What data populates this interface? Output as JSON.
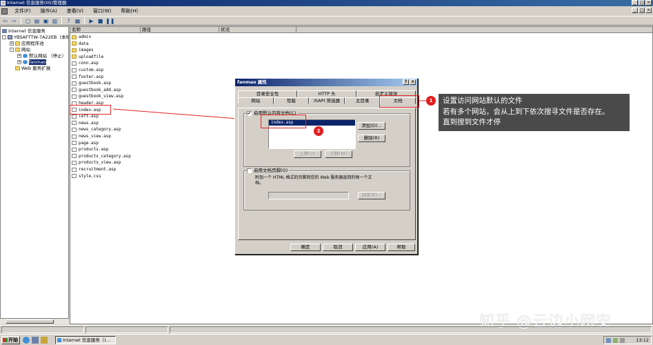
{
  "window": {
    "title": "Internet 信息服务(IIS)管理器",
    "min_glyph": "_",
    "max_glyph": "□",
    "close_glyph": "×"
  },
  "menu": {
    "items": [
      "文件(F)",
      "操作(A)",
      "查看(V)",
      "窗口(W)",
      "帮助(H)"
    ]
  },
  "toolbar": {
    "buttons": [
      "back-icon",
      "forward-icon",
      "up-icon",
      "show-hide-icon",
      "refresh-icon",
      "export-icon",
      "help-icon",
      "properties-icon",
      "play-icon",
      "stop-icon",
      "pause-icon"
    ],
    "glyphs": [
      "⇦",
      "⇨",
      "▢",
      "▤",
      "▣",
      "▥",
      "?",
      "▦",
      "▶",
      "■",
      "❚❚"
    ]
  },
  "tree": {
    "items": [
      {
        "label": "Internet 信息服务",
        "icon": "iis-icon",
        "indent": 0,
        "expander": ""
      },
      {
        "label": "YBSAFTTW-7A22EB（本地）",
        "icon": "computer-icon",
        "indent": 1,
        "expander": "-"
      },
      {
        "label": "应用程序池",
        "icon": "folder-icon",
        "indent": 2,
        "expander": "+"
      },
      {
        "label": "网站",
        "icon": "folder-icon",
        "indent": 2,
        "expander": "-"
      },
      {
        "label": "默认网站 （停止）",
        "icon": "globe-icon",
        "indent": 3,
        "expander": "+"
      },
      {
        "label": "fanmao",
        "icon": "globe-icon",
        "indent": 3,
        "expander": "+",
        "selected": true
      },
      {
        "label": "Web 服务扩展",
        "icon": "folder-icon",
        "indent": 2,
        "expander": ""
      }
    ]
  },
  "list": {
    "columns": [
      "名称",
      "路径",
      "状况"
    ],
    "rows": [
      {
        "name": "admin",
        "type": "folder"
      },
      {
        "name": "data",
        "type": "folder"
      },
      {
        "name": "images",
        "type": "folder"
      },
      {
        "name": "uploadfile",
        "type": "folder"
      },
      {
        "name": "conn.asp",
        "type": "file"
      },
      {
        "name": "custom.asp",
        "type": "file"
      },
      {
        "name": "footer.asp",
        "type": "file"
      },
      {
        "name": "guestbook.asp",
        "type": "file"
      },
      {
        "name": "guestbook_add.asp",
        "type": "file"
      },
      {
        "name": "guestbook_view.asp",
        "type": "file"
      },
      {
        "name": "header.asp",
        "type": "file"
      },
      {
        "name": "index.asp",
        "type": "file"
      },
      {
        "name": "left.asp",
        "type": "file"
      },
      {
        "name": "news.asp",
        "type": "file"
      },
      {
        "name": "news_category.asp",
        "type": "file"
      },
      {
        "name": "news_view.asp",
        "type": "file"
      },
      {
        "name": "page.asp",
        "type": "file"
      },
      {
        "name": "products.asp",
        "type": "file"
      },
      {
        "name": "products_category.asp",
        "type": "file"
      },
      {
        "name": "products_view.asp",
        "type": "file"
      },
      {
        "name": "recruitment.asp",
        "type": "file"
      },
      {
        "name": "style.css",
        "type": "file"
      }
    ]
  },
  "dialog": {
    "title": "fanmao 属性",
    "help_glyph": "?",
    "close_glyph": "×",
    "tabs_row1": [
      "目录安全性",
      "HTTP 头",
      "自定义错误"
    ],
    "tabs_row2": [
      "网站",
      "性能",
      "ISAPI 筛选器",
      "主目录",
      "文档"
    ],
    "enable_default_label": "启用默认内容文档(C)",
    "enable_default_checked": "✔",
    "default_docs": [
      "index.asp"
    ],
    "add_button": "添加(D)...",
    "remove_button": "删除(R)",
    "move_up_button": "上移(U)",
    "move_down_button": "下移(W)",
    "enable_footer_label": "启用文档页脚(O)",
    "footer_desc": "附加一个 HTML 格式的页脚到您的 Web 服务器返回的每一个文档。",
    "browse_button": "浏览(B)...",
    "ok_button": "确定",
    "cancel_button": "取消",
    "apply_button": "应用(A)",
    "help_button": "帮助"
  },
  "annotations": {
    "badge1": "1",
    "badge2": "2",
    "callout_lines": [
      "设置访问网站默认的文件",
      "若有多个网站，会从上到下依次搜寻文件是否存在。",
      "直到搜到文件才停"
    ],
    "accent_color": "#e02020"
  },
  "watermark": "知乎 @云边小网安",
  "taskbar": {
    "start": "开始",
    "task": "Internet 信息服务（I...",
    "clock": "13:12"
  }
}
